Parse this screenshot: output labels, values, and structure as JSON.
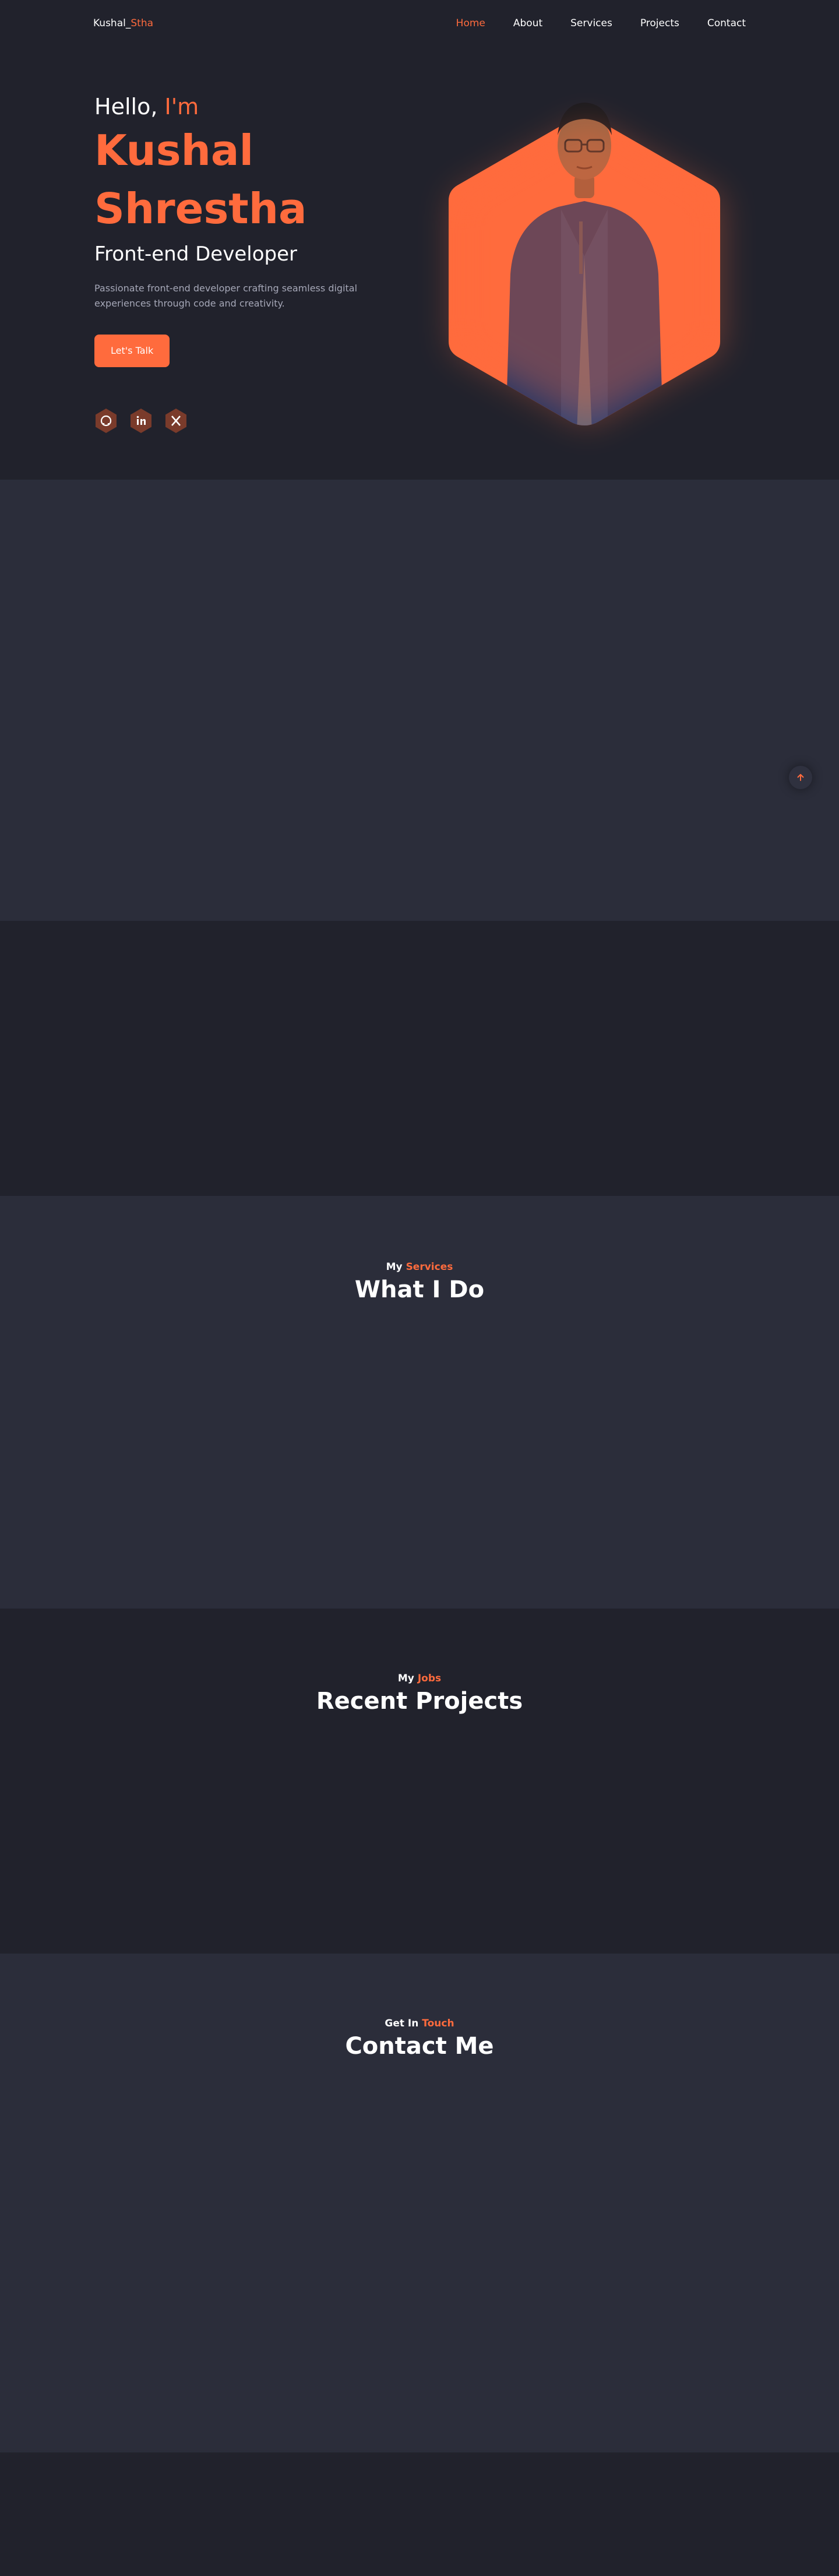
{
  "nav": {
    "logo_main": "Kushal_",
    "logo_accent": "Stha",
    "links": [
      "Home",
      "About",
      "Services",
      "Projects",
      "Contact"
    ],
    "active": "Home"
  },
  "hero": {
    "hello": "Hello,",
    "im": "I'm",
    "first_name": "Kushal",
    "last_name": "Shrestha",
    "role": "Front-end Developer",
    "description": "Passionate front-end developer crafting seamless digital experiences through code and creativity.",
    "cta_label": "Let's Talk",
    "socials": [
      "github-icon",
      "linkedin-icon",
      "x-icon"
    ]
  },
  "services": {
    "eyebrow_main": "My",
    "eyebrow_accent": "Services",
    "title": "What I Do"
  },
  "projects": {
    "eyebrow_main": "My",
    "eyebrow_accent": "Jobs",
    "title": "Recent Projects"
  },
  "contact": {
    "eyebrow_main": "Get In",
    "eyebrow_accent": "Touch",
    "title": "Contact Me"
  },
  "colors": {
    "accent": "#ff6b3d",
    "bg_dark": "#21222c",
    "bg_alt": "#2b2d3a",
    "text_muted": "#a6a8b8"
  }
}
